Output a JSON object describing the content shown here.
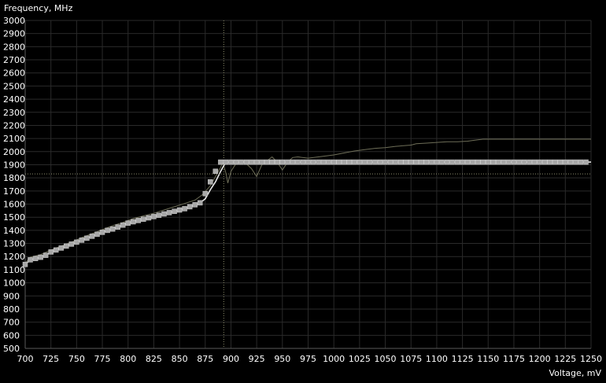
{
  "chart_data": {
    "type": "line",
    "title": "",
    "ylabel": "Frequency, MHz",
    "xlabel": "Voltage, mV",
    "xlim": [
      700,
      1250
    ],
    "ylim": [
      500,
      3000
    ],
    "x_ticks": [
      700,
      725,
      750,
      775,
      800,
      825,
      850,
      875,
      900,
      925,
      950,
      975,
      1000,
      1025,
      1050,
      1075,
      1100,
      1125,
      1150,
      1175,
      1200,
      1225,
      1250
    ],
    "y_ticks": [
      500,
      600,
      700,
      800,
      900,
      1000,
      1100,
      1200,
      1300,
      1400,
      1500,
      1600,
      1700,
      1800,
      1900,
      2000,
      2100,
      2200,
      2300,
      2400,
      2500,
      2600,
      2700,
      2800,
      2900,
      3000
    ],
    "grid": true,
    "cursor": {
      "x": 893,
      "y": 1830
    },
    "colors": {
      "background": "#000000",
      "grid": "#2a2a2a",
      "axis": "#5a5a5a",
      "text": "#ffffff",
      "curve": "#e6e6e6",
      "markers": "#a8a8a8",
      "default_curve": "#6e6e58",
      "cursor": "#8a8a6a"
    },
    "series": [
      {
        "role": "default_curve",
        "points": [
          [
            700,
            1150
          ],
          [
            705,
            1195
          ],
          [
            715,
            1215
          ],
          [
            725,
            1250
          ],
          [
            735,
            1280
          ],
          [
            745,
            1310
          ],
          [
            755,
            1345
          ],
          [
            765,
            1375
          ],
          [
            775,
            1405
          ],
          [
            785,
            1435
          ],
          [
            795,
            1460
          ],
          [
            805,
            1490
          ],
          [
            815,
            1510
          ],
          [
            825,
            1530
          ],
          [
            835,
            1555
          ],
          [
            845,
            1580
          ],
          [
            855,
            1605
          ],
          [
            865,
            1630
          ],
          [
            872,
            1670
          ],
          [
            880,
            1740
          ],
          [
            885,
            1810
          ],
          [
            890,
            1880
          ],
          [
            892,
            1920
          ],
          [
            895,
            1840
          ],
          [
            897,
            1760
          ],
          [
            900,
            1850
          ],
          [
            905,
            1910
          ],
          [
            912,
            1930
          ],
          [
            920,
            1870
          ],
          [
            925,
            1810
          ],
          [
            930,
            1900
          ],
          [
            940,
            1960
          ],
          [
            945,
            1920
          ],
          [
            950,
            1860
          ],
          [
            955,
            1920
          ],
          [
            960,
            1955
          ],
          [
            965,
            1960
          ],
          [
            975,
            1950
          ],
          [
            985,
            1960
          ],
          [
            1000,
            1975
          ],
          [
            1010,
            1990
          ],
          [
            1020,
            2005
          ],
          [
            1030,
            2015
          ],
          [
            1040,
            2025
          ],
          [
            1050,
            2030
          ],
          [
            1060,
            2040
          ],
          [
            1075,
            2050
          ],
          [
            1080,
            2060
          ],
          [
            1090,
            2065
          ],
          [
            1100,
            2070
          ],
          [
            1110,
            2075
          ],
          [
            1120,
            2075
          ],
          [
            1130,
            2080
          ],
          [
            1135,
            2085
          ],
          [
            1140,
            2090
          ],
          [
            1145,
            2095
          ],
          [
            1250,
            2095
          ]
        ]
      },
      {
        "role": "curve",
        "points": [
          [
            700,
            1140
          ],
          [
            705,
            1175
          ],
          [
            710,
            1185
          ],
          [
            715,
            1195
          ],
          [
            720,
            1210
          ],
          [
            725,
            1235
          ],
          [
            730,
            1250
          ],
          [
            735,
            1265
          ],
          [
            740,
            1280
          ],
          [
            745,
            1295
          ],
          [
            750,
            1310
          ],
          [
            755,
            1325
          ],
          [
            760,
            1340
          ],
          [
            765,
            1355
          ],
          [
            770,
            1370
          ],
          [
            775,
            1385
          ],
          [
            780,
            1400
          ],
          [
            785,
            1410
          ],
          [
            790,
            1425
          ],
          [
            795,
            1440
          ],
          [
            800,
            1455
          ],
          [
            805,
            1465
          ],
          [
            810,
            1475
          ],
          [
            815,
            1485
          ],
          [
            820,
            1495
          ],
          [
            825,
            1505
          ],
          [
            830,
            1515
          ],
          [
            835,
            1525
          ],
          [
            840,
            1535
          ],
          [
            845,
            1545
          ],
          [
            850,
            1555
          ],
          [
            855,
            1565
          ],
          [
            860,
            1580
          ],
          [
            865,
            1595
          ],
          [
            870,
            1610
          ],
          [
            875,
            1640
          ],
          [
            880,
            1710
          ],
          [
            885,
            1770
          ],
          [
            890,
            1850
          ],
          [
            895,
            1920
          ],
          [
            1250,
            1920
          ]
        ]
      }
    ],
    "marker_points": [
      [
        700,
        1140
      ],
      [
        705,
        1175
      ],
      [
        710,
        1185
      ],
      [
        715,
        1195
      ],
      [
        720,
        1210
      ],
      [
        725,
        1235
      ],
      [
        730,
        1250
      ],
      [
        735,
        1265
      ],
      [
        740,
        1280
      ],
      [
        745,
        1295
      ],
      [
        750,
        1310
      ],
      [
        755,
        1325
      ],
      [
        760,
        1340
      ],
      [
        765,
        1355
      ],
      [
        770,
        1370
      ],
      [
        775,
        1385
      ],
      [
        780,
        1400
      ],
      [
        785,
        1410
      ],
      [
        790,
        1425
      ],
      [
        795,
        1440
      ],
      [
        800,
        1455
      ],
      [
        805,
        1465
      ],
      [
        810,
        1475
      ],
      [
        815,
        1485
      ],
      [
        820,
        1495
      ],
      [
        825,
        1505
      ],
      [
        830,
        1515
      ],
      [
        835,
        1525
      ],
      [
        840,
        1535
      ],
      [
        845,
        1545
      ],
      [
        850,
        1555
      ],
      [
        855,
        1565
      ],
      [
        860,
        1580
      ],
      [
        865,
        1595
      ],
      [
        870,
        1610
      ],
      [
        875,
        1680
      ],
      [
        880,
        1770
      ],
      [
        885,
        1850
      ],
      [
        890,
        1920
      ],
      [
        895,
        1920
      ],
      [
        900,
        1920
      ],
      [
        905,
        1920
      ],
      [
        910,
        1920
      ],
      [
        915,
        1920
      ],
      [
        920,
        1920
      ],
      [
        925,
        1920
      ],
      [
        930,
        1920
      ],
      [
        935,
        1920
      ],
      [
        940,
        1920
      ],
      [
        945,
        1920
      ],
      [
        950,
        1920
      ],
      [
        955,
        1920
      ],
      [
        960,
        1920
      ],
      [
        965,
        1920
      ],
      [
        970,
        1920
      ],
      [
        975,
        1920
      ],
      [
        980,
        1920
      ],
      [
        985,
        1920
      ],
      [
        990,
        1920
      ],
      [
        995,
        1920
      ],
      [
        1000,
        1920
      ],
      [
        1005,
        1920
      ],
      [
        1010,
        1920
      ],
      [
        1015,
        1920
      ],
      [
        1020,
        1920
      ],
      [
        1025,
        1920
      ],
      [
        1030,
        1920
      ],
      [
        1035,
        1920
      ],
      [
        1040,
        1920
      ],
      [
        1045,
        1920
      ],
      [
        1050,
        1920
      ],
      [
        1055,
        1920
      ],
      [
        1060,
        1920
      ],
      [
        1065,
        1920
      ],
      [
        1070,
        1920
      ],
      [
        1075,
        1920
      ],
      [
        1080,
        1920
      ],
      [
        1085,
        1920
      ],
      [
        1090,
        1920
      ],
      [
        1095,
        1920
      ],
      [
        1100,
        1920
      ],
      [
        1105,
        1920
      ],
      [
        1110,
        1920
      ],
      [
        1115,
        1920
      ],
      [
        1120,
        1920
      ],
      [
        1125,
        1920
      ],
      [
        1130,
        1920
      ],
      [
        1135,
        1920
      ],
      [
        1140,
        1920
      ],
      [
        1145,
        1920
      ],
      [
        1150,
        1920
      ],
      [
        1155,
        1920
      ],
      [
        1160,
        1920
      ],
      [
        1165,
        1920
      ],
      [
        1170,
        1920
      ],
      [
        1175,
        1920
      ],
      [
        1180,
        1920
      ],
      [
        1185,
        1920
      ],
      [
        1190,
        1920
      ],
      [
        1195,
        1920
      ],
      [
        1200,
        1920
      ],
      [
        1205,
        1920
      ],
      [
        1210,
        1920
      ],
      [
        1215,
        1920
      ],
      [
        1220,
        1920
      ],
      [
        1225,
        1920
      ],
      [
        1230,
        1920
      ],
      [
        1235,
        1920
      ],
      [
        1240,
        1920
      ],
      [
        1245,
        1920
      ]
    ]
  }
}
